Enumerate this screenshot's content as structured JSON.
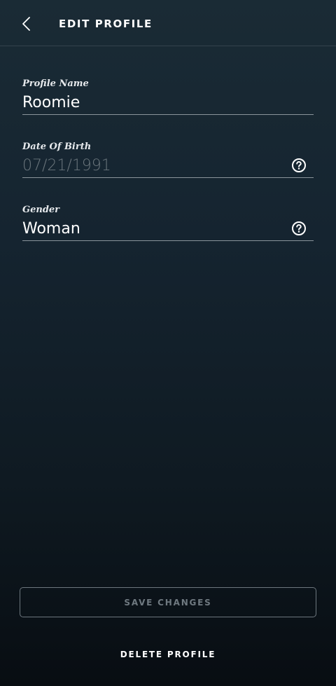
{
  "header": {
    "title": "EDIT PROFILE",
    "back_icon": "chevron-left-icon"
  },
  "form": {
    "profile_name": {
      "label": "Profile Name",
      "value": "Roomie"
    },
    "date_of_birth": {
      "label": "Date Of Birth",
      "value": "07/21/1991",
      "editable": false,
      "help_icon": "question-circle-icon"
    },
    "gender": {
      "label": "Gender",
      "value": "Woman",
      "help_icon": "question-circle-icon"
    }
  },
  "actions": {
    "save_label": "SAVE CHANGES",
    "save_enabled": false,
    "delete_label": "DELETE PROFILE"
  },
  "colors": {
    "background_top": "#1a2b35",
    "background_bottom": "#080d12",
    "text_primary": "#ffffff",
    "text_disabled": "#6b767d",
    "divider": "#8a949b"
  }
}
